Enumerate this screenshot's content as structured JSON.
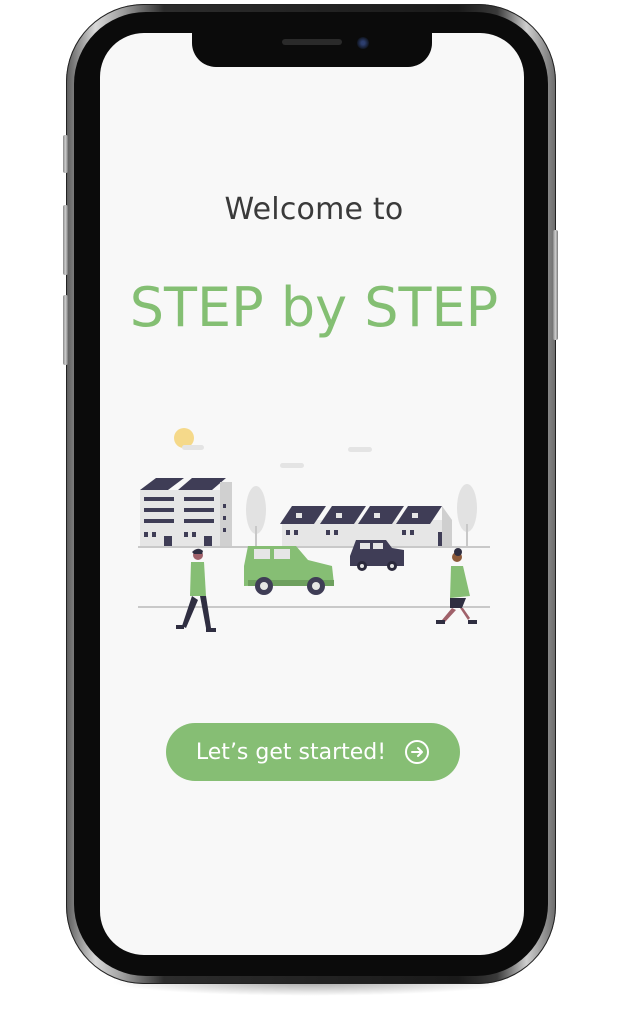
{
  "screen": {
    "welcome_text": "Welcome to",
    "app_name": "STEP by STEP",
    "cta_label": "Let’s get started!",
    "cta_icon": "arrow-right-circle-icon"
  },
  "colors": {
    "accent": "#86be74",
    "title": "#84bf73",
    "text": "#3a3a3a",
    "screen_bg": "#f8f8f8",
    "illustration_dark": "#3f3d56"
  }
}
